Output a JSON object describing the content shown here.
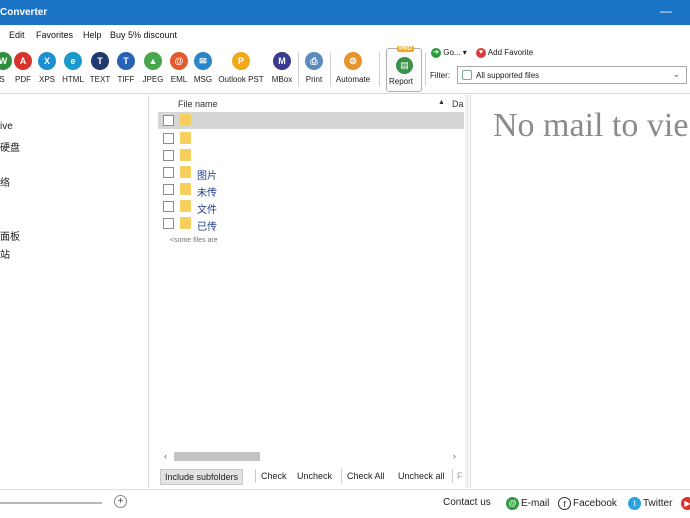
{
  "window": {
    "title": "Converter",
    "minimize_glyph": "—"
  },
  "menu": [
    "Edit",
    "Favorites",
    "Help",
    "Buy 5% discount"
  ],
  "toolbar": {
    "tools": [
      {
        "label": "S",
        "icon": "doc-icon",
        "color": "#2f8f3b"
      },
      {
        "label": "PDF",
        "icon": "pdf-icon",
        "color": "#d9342b"
      },
      {
        "label": "XPS",
        "icon": "xps-icon",
        "color": "#1b8fd1"
      },
      {
        "label": "HTML",
        "icon": "html-icon",
        "color": "#1a9acb"
      },
      {
        "label": "TEXT",
        "icon": "text-icon",
        "color": "#1f3a6e"
      },
      {
        "label": "TIFF",
        "icon": "tiff-icon",
        "color": "#2862b6"
      },
      {
        "label": "JPEG",
        "icon": "jpeg-icon",
        "color": "#45a64b"
      },
      {
        "label": "EML",
        "icon": "eml-icon",
        "color": "#e25a2d"
      },
      {
        "label": "MSG",
        "icon": "msg-icon",
        "color": "#2a86c9"
      },
      {
        "label": "Outlook PST",
        "icon": "pst-icon",
        "color": "#f0a818"
      },
      {
        "label": "MBox",
        "icon": "mbox-icon",
        "color": "#3b3b8f"
      },
      {
        "label": "Print",
        "icon": "print-icon",
        "color": "#5a8bbf"
      },
      {
        "label": "Automate",
        "icon": "automate-icon",
        "color": "#e8932c"
      }
    ],
    "report": {
      "label": "Report",
      "badge": "PRO",
      "icon": "report-icon"
    },
    "go_label": "Go... ▾",
    "add_favorite_label": "Add Favorite",
    "filter_label": "Filter:",
    "filter_value": "All supported files"
  },
  "tree": {
    "nodes": [
      "ive",
      "硬盘",
      "络",
      "面板",
      "站"
    ]
  },
  "file_list": {
    "column_name": "File name",
    "column_date": "Da",
    "rows": [
      {
        "name": "",
        "selected": true
      },
      {
        "name": "",
        "selected": false
      },
      {
        "name": "",
        "selected": false
      },
      {
        "name": "图片",
        "selected": false
      },
      {
        "name": "未传",
        "selected": false
      },
      {
        "name": "文件",
        "selected": false
      },
      {
        "name": "已传",
        "selected": false
      }
    ],
    "note": "<some files are"
  },
  "bottom_tools": {
    "include_subfolders": "Include subfolders",
    "check": "Check",
    "uncheck": "Uncheck",
    "check_all": "Check All",
    "uncheck_all": "Uncheck all",
    "trailing": "F"
  },
  "preview": {
    "message": "No mail to vie"
  },
  "status": {
    "contact": "Contact us",
    "email": "E-mail",
    "facebook": "Facebook",
    "twitter": "Twitter"
  }
}
